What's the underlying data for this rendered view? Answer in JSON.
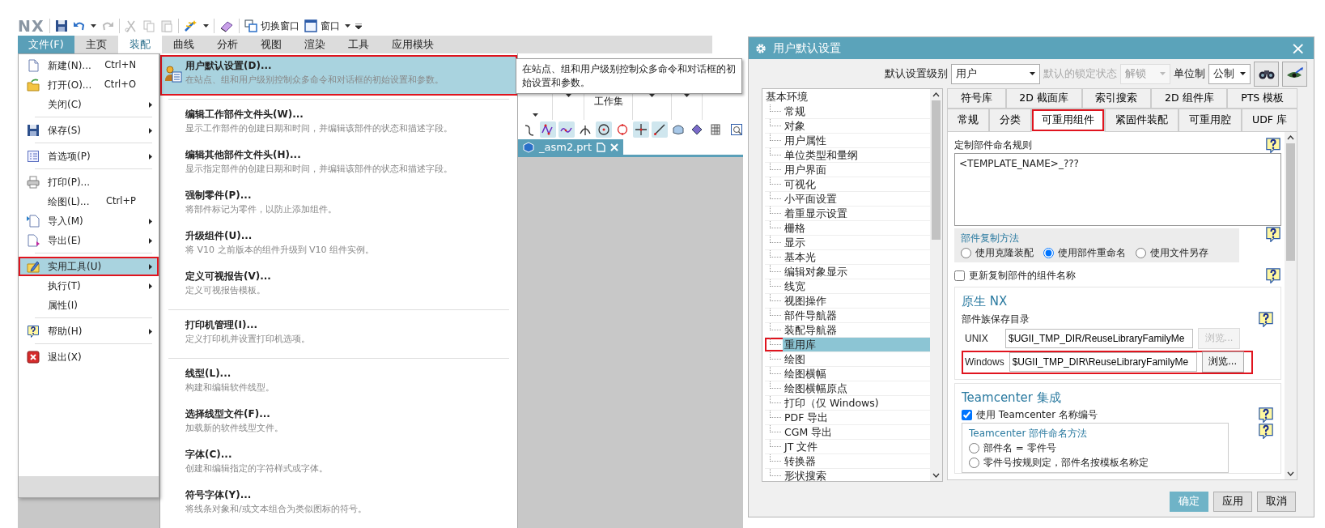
{
  "nx_window": {
    "quick_access": {
      "logo": "NX",
      "switch_window": "切换窗口",
      "window_menu": "窗口"
    },
    "ribbon_tabs": [
      {
        "label": "文件(F)",
        "kind": "file",
        "selected": false
      },
      {
        "label": "主页",
        "kind": "tab",
        "selected": false
      },
      {
        "label": "装配",
        "kind": "tab",
        "selected": true
      },
      {
        "label": "曲线",
        "kind": "tab",
        "selected": false
      },
      {
        "label": "分析",
        "kind": "tab",
        "selected": false
      },
      {
        "label": "视图",
        "kind": "tab",
        "selected": false
      },
      {
        "label": "渲染",
        "kind": "tab",
        "selected": false
      },
      {
        "label": "工具",
        "kind": "tab",
        "selected": false
      },
      {
        "label": "应用模块",
        "kind": "tab",
        "selected": false
      }
    ],
    "ribbon_group": {
      "label": "工作集"
    },
    "document_tab": {
      "label": "_asm2.prt"
    },
    "file_menu": [
      {
        "kind": "item",
        "label": "新建(N)...",
        "shortcut": "Ctrl+N",
        "submenu": false,
        "highlighted": false,
        "boxed": false
      },
      {
        "kind": "item",
        "label": "打开(O)...",
        "shortcut": "Ctrl+O",
        "submenu": false,
        "highlighted": false,
        "boxed": false
      },
      {
        "kind": "item",
        "label": "关闭(C)",
        "submenu": true,
        "highlighted": false,
        "boxed": false
      },
      {
        "kind": "separator"
      },
      {
        "kind": "item",
        "label": "保存(S)",
        "submenu": true,
        "highlighted": false,
        "boxed": false
      },
      {
        "kind": "separator"
      },
      {
        "kind": "item",
        "label": "首选项(P)",
        "submenu": true,
        "highlighted": false,
        "boxed": false
      },
      {
        "kind": "separator"
      },
      {
        "kind": "item",
        "label": "打印(P)...",
        "submenu": false,
        "highlighted": false,
        "boxed": false
      },
      {
        "kind": "item",
        "label": "绘图(L)...",
        "shortcut": "Ctrl+P",
        "submenu": false,
        "highlighted": false,
        "boxed": false
      },
      {
        "kind": "item",
        "label": "导入(M)",
        "submenu": true,
        "highlighted": false,
        "boxed": false
      },
      {
        "kind": "item",
        "label": "导出(E)",
        "submenu": true,
        "highlighted": false,
        "boxed": false
      },
      {
        "kind": "separator"
      },
      {
        "kind": "item",
        "label": "实用工具(U)",
        "submenu": true,
        "highlighted": true,
        "boxed": true
      },
      {
        "kind": "item",
        "label": "执行(T)",
        "submenu": true,
        "highlighted": false,
        "boxed": false
      },
      {
        "kind": "item",
        "label": "属性(I)",
        "submenu": false,
        "highlighted": false,
        "boxed": false
      },
      {
        "kind": "separator"
      },
      {
        "kind": "item",
        "label": "帮助(H)",
        "submenu": true,
        "highlighted": false,
        "boxed": false
      },
      {
        "kind": "separator"
      },
      {
        "kind": "item",
        "label": "退出(X)",
        "submenu": false,
        "highlighted": false,
        "boxed": false
      }
    ],
    "utilities_menu": [
      {
        "kind": "item",
        "title": "用户默认设置(D)...",
        "description": "在站点、组和用户级别控制众多命令和对话框的初始设置和参数。",
        "highlighted": true,
        "boxed": true
      },
      {
        "kind": "separator"
      },
      {
        "kind": "item",
        "title": "编辑工作部件文件头(W)...",
        "description": "显示工作部件的创建日期和时间，并编辑该部件的状态和描述字段。",
        "highlighted": false,
        "boxed": false
      },
      {
        "kind": "item",
        "title": "编辑其他部件文件头(H)...",
        "description": "显示指定部件的创建日期和时间，并编辑该部件的状态和描述字段。",
        "highlighted": false,
        "boxed": false
      },
      {
        "kind": "item",
        "title": "强制零件(P)...",
        "description": "将部件标记为零件，以防止添加组件。",
        "highlighted": false,
        "boxed": false
      },
      {
        "kind": "item",
        "title": "升级组件(U)...",
        "description": "将 V10 之前版本的组件升级到 V10 组件实例。",
        "highlighted": false,
        "boxed": false
      },
      {
        "kind": "item",
        "title": "定义可视报告(V)...",
        "description": "定义可视报告模板。",
        "highlighted": false,
        "boxed": false
      },
      {
        "kind": "separator"
      },
      {
        "kind": "item",
        "title": "打印机管理(I)...",
        "description": "定义打印机并设置打印机选项。",
        "highlighted": false,
        "boxed": false
      },
      {
        "kind": "separator"
      },
      {
        "kind": "item",
        "title": "线型(L)...",
        "description": "构建和编辑软件线型。",
        "highlighted": false,
        "boxed": false
      },
      {
        "kind": "item",
        "title": "选择线型文件(F)...",
        "description": "加载新的软件线型文件。",
        "highlighted": false,
        "boxed": false
      },
      {
        "kind": "item",
        "title": "字体(C)...",
        "description": "创建和编辑指定的字符样式或字体。",
        "highlighted": false,
        "boxed": false
      },
      {
        "kind": "item",
        "title": "符号字体(Y)...",
        "description": "将线条对象和/或文本组合为类似图标的符号。",
        "highlighted": false,
        "boxed": false
      }
    ],
    "tooltip": {
      "text": "在站点、组和用户级别控制众多命令和对话框的初始设置和参数。"
    }
  },
  "dialog": {
    "title": "用户默认设置",
    "close": "×",
    "toolbar": {
      "level_label": "默认设置级别",
      "level_value": "用户",
      "lock_label": "默认的锁定状态",
      "lock_value": "解锁",
      "lock_disabled": true,
      "unit_label": "单位制",
      "unit_value": "公制"
    },
    "tree": {
      "label": "基本环境",
      "children": [
        {
          "label": "常规",
          "selected": false,
          "boxed": false
        },
        {
          "label": "对象",
          "selected": false,
          "boxed": false
        },
        {
          "label": "用户属性",
          "selected": false,
          "boxed": false
        },
        {
          "label": "单位类型和量纲",
          "selected": false,
          "boxed": false
        },
        {
          "label": "用户界面",
          "selected": false,
          "boxed": false
        },
        {
          "label": "可视化",
          "selected": false,
          "boxed": false
        },
        {
          "label": "小平面设置",
          "selected": false,
          "boxed": false
        },
        {
          "label": "着重显示设置",
          "selected": false,
          "boxed": false
        },
        {
          "label": "栅格",
          "selected": false,
          "boxed": false
        },
        {
          "label": "显示",
          "selected": false,
          "boxed": false
        },
        {
          "label": "基本光",
          "selected": false,
          "boxed": false
        },
        {
          "label": "编辑对象显示",
          "selected": false,
          "boxed": false
        },
        {
          "label": "线宽",
          "selected": false,
          "boxed": false
        },
        {
          "label": "视图操作",
          "selected": false,
          "boxed": false
        },
        {
          "label": "部件导航器",
          "selected": false,
          "boxed": false
        },
        {
          "label": "装配导航器",
          "selected": false,
          "boxed": false
        },
        {
          "label": "重用库",
          "selected": true,
          "boxed": true
        },
        {
          "label": "绘图",
          "selected": false,
          "boxed": false
        },
        {
          "label": "绘图横幅",
          "selected": false,
          "boxed": false
        },
        {
          "label": "绘图横幅原点",
          "selected": false,
          "boxed": false
        },
        {
          "label": "打印（仅 Windows)",
          "selected": false,
          "boxed": false
        },
        {
          "label": "PDF 导出",
          "selected": false,
          "boxed": false
        },
        {
          "label": "CGM 导出",
          "selected": false,
          "boxed": false
        },
        {
          "label": "JT 文件",
          "selected": false,
          "boxed": false
        },
        {
          "label": "转换器",
          "selected": false,
          "boxed": false
        },
        {
          "label": "形状搜索",
          "selected": false,
          "boxed": false
        }
      ]
    },
    "tab_rows": [
      [
        {
          "label": "符号库",
          "selected": false,
          "boxed": false
        },
        {
          "label": "2D 截面库",
          "selected": false,
          "boxed": false
        },
        {
          "label": "索引搜索",
          "selected": false,
          "boxed": false
        },
        {
          "label": "2D 组件库",
          "selected": false,
          "boxed": false
        },
        {
          "label": "PTS 模板",
          "selected": false,
          "boxed": false
        }
      ],
      [
        {
          "label": "常规",
          "selected": false,
          "boxed": false
        },
        {
          "label": "分类",
          "selected": false,
          "boxed": false
        },
        {
          "label": "可重用组件",
          "selected": true,
          "boxed": true
        },
        {
          "label": "紧固件装配",
          "selected": false,
          "boxed": false
        },
        {
          "label": "可重用腔",
          "selected": false,
          "boxed": false
        },
        {
          "label": "UDF 库",
          "selected": false,
          "boxed": false
        }
      ]
    ],
    "naming_rule": {
      "label": "定制部件命名规则",
      "value": "<TEMPLATE_NAME>_???"
    },
    "copy_method": {
      "title": "部件复制方法",
      "options": [
        {
          "label": "使用克隆装配",
          "selected": false
        },
        {
          "label": "使用部件重命名",
          "selected": true
        },
        {
          "label": "使用文件另存",
          "selected": false
        }
      ]
    },
    "update_names": {
      "label": "更新复制部件的组件名称",
      "checked": false
    },
    "native_nx": {
      "title": "原生 NX",
      "dir_label": "部件族保存目录",
      "rows": [
        {
          "label": "UNIX",
          "value": "$UGII_TMP_DIR/ReuseLibraryFamilyMe",
          "button": "浏览...",
          "disabled": true,
          "boxed": false
        },
        {
          "label": "Windows",
          "value": "$UGII_TMP_DIR\\ReuseLibraryFamilyMe",
          "button": "浏览...",
          "disabled": false,
          "boxed": true
        }
      ]
    },
    "teamcenter": {
      "title": "Teamcenter 集成",
      "use_label": "使用 Teamcenter 名称编号",
      "checked": true,
      "method_title": "Teamcenter 部件命名方法",
      "options": [
        {
          "label": "部件名 = 零件号",
          "selected": false
        },
        {
          "label": "零件号按规则定，部件名按模板名称定",
          "selected": false
        }
      ]
    },
    "buttons": [
      {
        "label": "确定",
        "kind": "primary"
      },
      {
        "label": "应用",
        "kind": "default"
      },
      {
        "label": "取消",
        "kind": "default"
      }
    ]
  }
}
